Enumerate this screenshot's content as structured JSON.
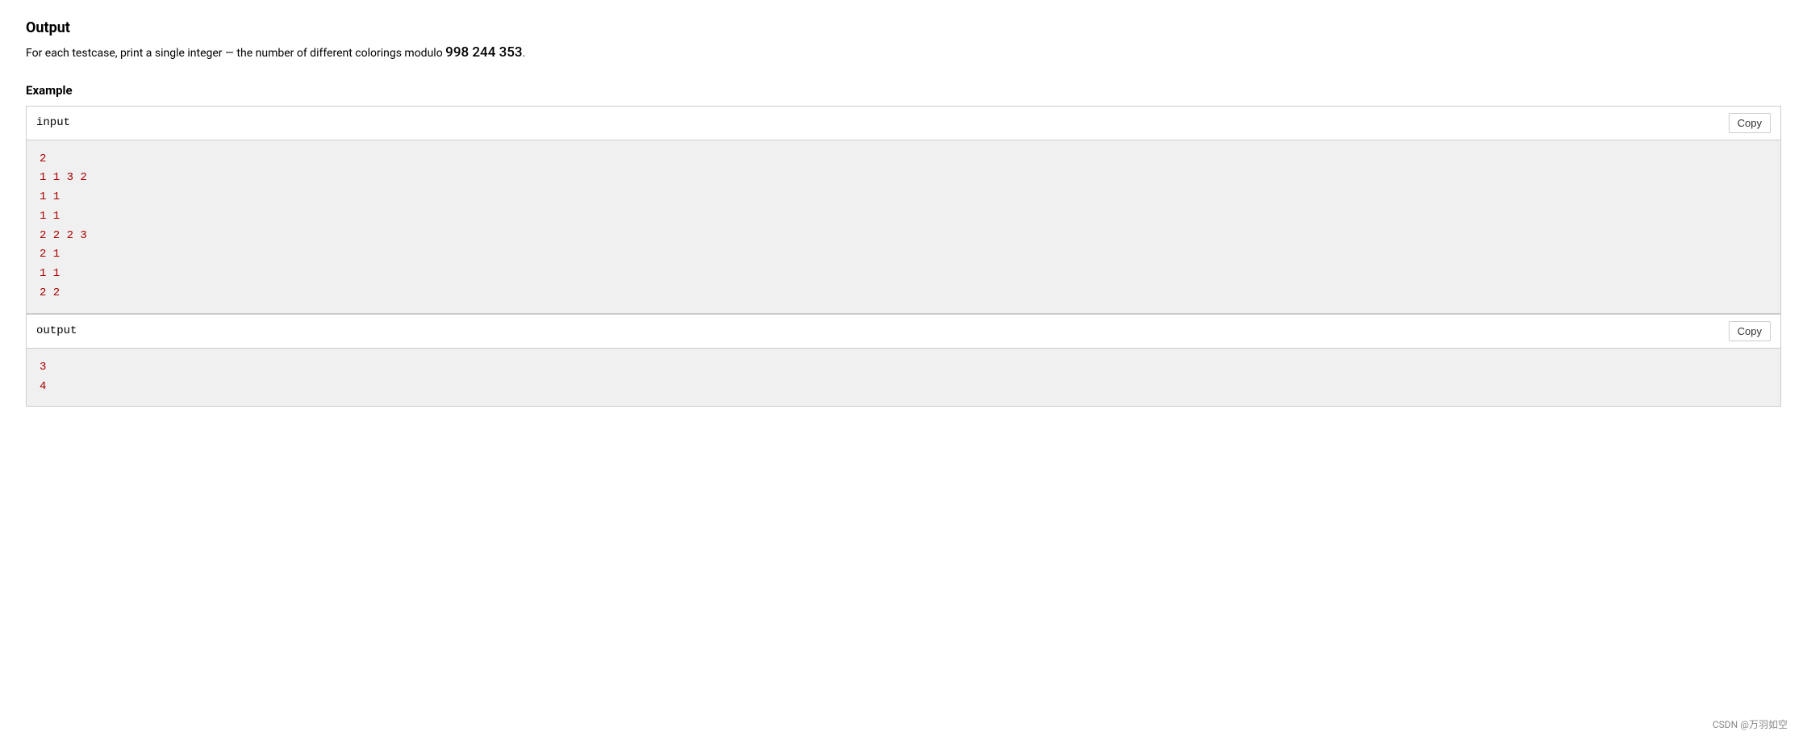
{
  "output": {
    "title": "Output",
    "description_prefix": "For each testcase, print a single integer — the number of different colorings modulo ",
    "modulo_number": "998 244 353",
    "description_suffix": "."
  },
  "example": {
    "title": "Example",
    "input": {
      "label": "input",
      "copy_label": "Copy",
      "lines": [
        "2",
        "1 1 3 2",
        "1 1",
        "1 1",
        "2 2 2 3",
        "2 1",
        "1 1",
        "2 2"
      ]
    },
    "output": {
      "label": "output",
      "copy_label": "Copy",
      "lines": [
        "3",
        "4"
      ]
    }
  },
  "footer": {
    "credit": "CSDN @万羽如空"
  }
}
